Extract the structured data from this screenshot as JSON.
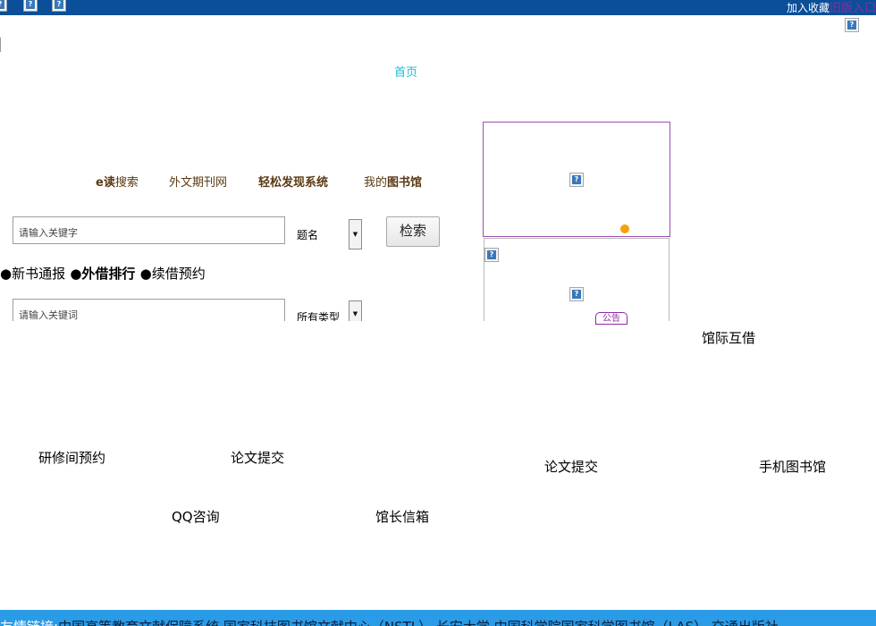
{
  "top_bar": {
    "add_favorite": "加入收藏",
    "old_version_entry": "旧版入口"
  },
  "nav": {
    "home": "首页"
  },
  "search_tabs": {
    "edu_search_prefix": "e读",
    "edu_search_suffix": "搜索",
    "foreign_journals": "外文期刊网",
    "discovery": "轻松发现系统",
    "my_library_prefix": "我的",
    "my_library_suffix": "图书馆"
  },
  "search": {
    "placeholder": "请输入关键字",
    "field_selected": "题名",
    "button": "检索"
  },
  "quick_links": {
    "new_books_prefix": "●新书通报",
    "loan_rank": " ●外借排行 ●",
    "renew_reserve": "续借预约"
  },
  "search2": {
    "placeholder": "请输入关键词",
    "type_selected": "所有类型"
  },
  "notice": {
    "tab_label": "公告"
  },
  "services": {
    "interlibrary": "馆际互借",
    "study_room": "研修间预约",
    "thesis_submit_1": "论文提交",
    "thesis_submit_2": "论文提交",
    "mobile_library": "手机图书馆",
    "qq_consult": "QQ咨询",
    "director_mailbox": "馆长信箱"
  },
  "footer": {
    "label": "友情链接:",
    "links": "中国高等教育文献保障系统  国家科技图书馆文献中心（NSTL）  长安大学  中国科学院国家科学图书馆（LAS）  交通出版社"
  },
  "icons": {
    "broken_image": "broken-image-icon"
  },
  "colors": {
    "top_bar": "#0a4f97",
    "home_link": "#26b8d6",
    "tab_text": "#5a3a13",
    "panel_border": "#9a4fb0",
    "footer_bg": "#2a9be6",
    "dot": "#f2a40a"
  }
}
